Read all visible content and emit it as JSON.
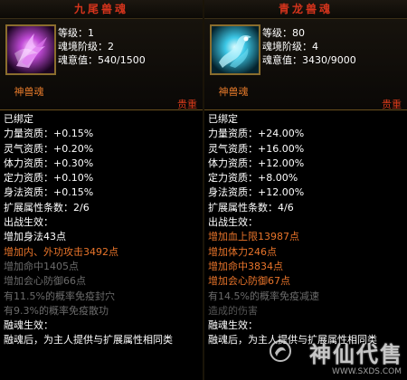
{
  "left": {
    "title": "九尾兽魂",
    "stats": [
      "等级：1",
      "魂境阶级：2",
      "魂意值：540/1500"
    ],
    "soul_name": "神兽魂",
    "quality": "贵重",
    "lines": [
      {
        "text": "已绑定",
        "style": "white"
      },
      {
        "text": "力量资质：+0.15%",
        "style": "white"
      },
      {
        "text": "灵气资质：+0.20%",
        "style": "white"
      },
      {
        "text": "体力资质：+0.30%",
        "style": "white"
      },
      {
        "text": "定力资质：+0.10%",
        "style": "white"
      },
      {
        "text": "身法资质：+0.15%",
        "style": "white"
      },
      {
        "text": "扩展属性条数：2/6",
        "style": "white"
      },
      {
        "text": "出战生效：",
        "style": "white"
      },
      {
        "text": "增加身法43点",
        "style": "white"
      },
      {
        "text": "增加内、外功攻击3492点",
        "style": "orange"
      },
      {
        "text": "增加命中1405点",
        "style": "gray"
      },
      {
        "text": "增加会心防御66点",
        "style": "gray"
      },
      {
        "text": "有11.5%的概率免疫封穴",
        "style": "gray"
      },
      {
        "text": "有9.3%的概率免疫散功",
        "style": "gray"
      },
      {
        "text": "融魂生效：",
        "style": "white"
      },
      {
        "text": "融魂后，为主人提供与扩展属性相同类",
        "style": "white"
      }
    ]
  },
  "right": {
    "title": "青龙兽魂",
    "stats": [
      "等级：80",
      "魂境阶级：4",
      "魂意值：3430/9000"
    ],
    "soul_name": "神兽魂",
    "quality": "贵重",
    "lines": [
      {
        "text": "已绑定",
        "style": "white"
      },
      {
        "text": "力量资质：+24.00%",
        "style": "white"
      },
      {
        "text": "灵气资质：+16.00%",
        "style": "white"
      },
      {
        "text": "体力资质：+12.00%",
        "style": "white"
      },
      {
        "text": "定力资质：+8.00%",
        "style": "white"
      },
      {
        "text": "身法资质：+12.00%",
        "style": "white"
      },
      {
        "text": "扩展属性条数：4/6",
        "style": "white"
      },
      {
        "text": "出战生效：",
        "style": "white"
      },
      {
        "text": "增加血上限13987点",
        "style": "orange"
      },
      {
        "text": "增加体力246点",
        "style": "orange"
      },
      {
        "text": "增加命中3834点",
        "style": "orange"
      },
      {
        "text": "增加会心防御67点",
        "style": "orange"
      },
      {
        "text": "有14.5%的概率免疫减速",
        "style": "gray"
      },
      {
        "text": "造成的伤害",
        "style": "gray2"
      },
      {
        "text": "融魂生效：",
        "style": "white"
      },
      {
        "text": "融魂后，为主人提供与扩展属性相同类",
        "style": "white"
      }
    ]
  },
  "watermark": {
    "text": "神仙代售",
    "url": "WWW.SXDS.COM"
  },
  "colors": {
    "title": "#d6341c",
    "orange": "#e8742a",
    "gray": "#6b6b6b",
    "quality": "#d63a1a",
    "frame": "#8a6d2d"
  },
  "icons": {
    "left": "nine-tail-fox-soul-icon",
    "right": "azure-dragon-soul-icon"
  }
}
